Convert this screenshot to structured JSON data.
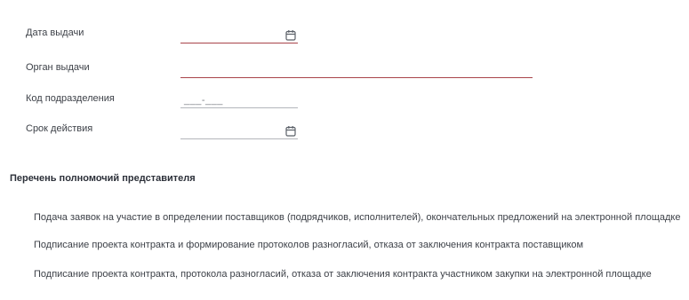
{
  "form": {
    "issue_date": {
      "label": "Дата выдачи",
      "value": ""
    },
    "issuer": {
      "label": "Орган выдачи",
      "value": ""
    },
    "division_code": {
      "label": "Код подразделения",
      "value": "___-___"
    },
    "validity": {
      "label": "Срок действия",
      "value": ""
    }
  },
  "authorities": {
    "title": "Перечень полномочий представителя",
    "items": [
      "Подача заявок на участие в определении поставщиков (подрядчиков, исполнителей), окончательных предложений на электронной площадке",
      "Подписание проекта контракта и формирование протоколов разногласий, отказа от заключения контракта поставщиком",
      "Подписание проекта контракта, протокола разногласий, отказа от заключения контракта участником закупки на электронной площадке"
    ]
  },
  "icons": {
    "calendar": "calendar-icon"
  },
  "colors": {
    "error_underline": "#a9444a",
    "normal_underline": "#b3b6bb",
    "text": "#3d4148"
  }
}
